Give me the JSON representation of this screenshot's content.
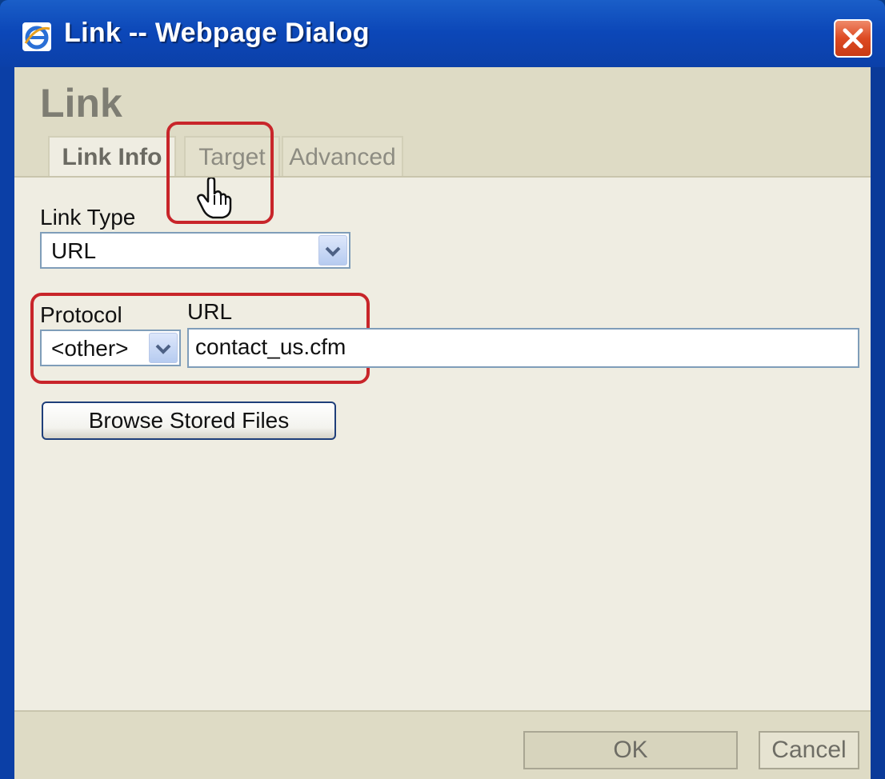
{
  "window": {
    "title": "Link -- Webpage Dialog"
  },
  "dialog": {
    "heading": "Link",
    "tabs": [
      {
        "label": "Link Info",
        "active": true
      },
      {
        "label": "Target",
        "active": false
      },
      {
        "label": "Advanced",
        "active": false
      }
    ],
    "link_type": {
      "label": "Link Type",
      "selected": "URL"
    },
    "protocol": {
      "label": "Protocol",
      "selected": "<other>"
    },
    "url": {
      "label": "URL",
      "value": "contact_us.cfm"
    },
    "browse_button": "Browse Stored Files",
    "ok_button": "OK",
    "cancel_button": "Cancel"
  },
  "colors": {
    "titlebar": "#0c47b8",
    "client_bg": "#efede2",
    "header_bg": "#dedbc5",
    "highlight": "#c8252a"
  },
  "icons": [
    "ie-icon",
    "close-icon",
    "chevron-down-icon",
    "hand-cursor-icon"
  ]
}
